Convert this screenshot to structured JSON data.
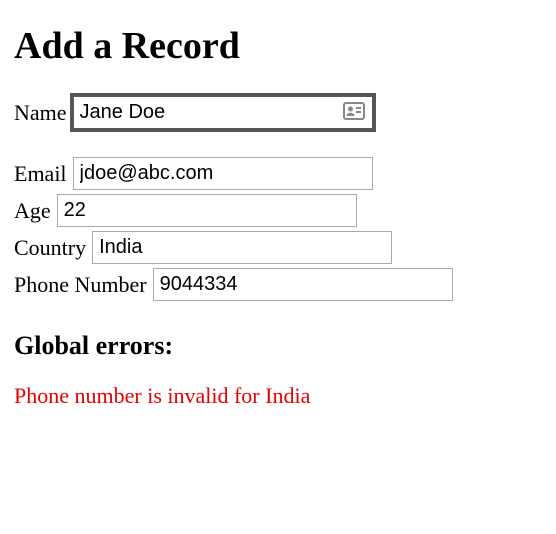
{
  "title": "Add a Record",
  "fields": {
    "name": {
      "label": "Name",
      "value": "Jane Doe"
    },
    "email": {
      "label": "Email",
      "value": "jdoe@abc.com"
    },
    "age": {
      "label": "Age",
      "value": "22"
    },
    "country": {
      "label": "Country",
      "value": "India"
    },
    "phone": {
      "label": "Phone Number",
      "value": "9044334"
    }
  },
  "errors": {
    "heading": "Global errors:",
    "messages": [
      "Phone number is invalid for India"
    ]
  }
}
